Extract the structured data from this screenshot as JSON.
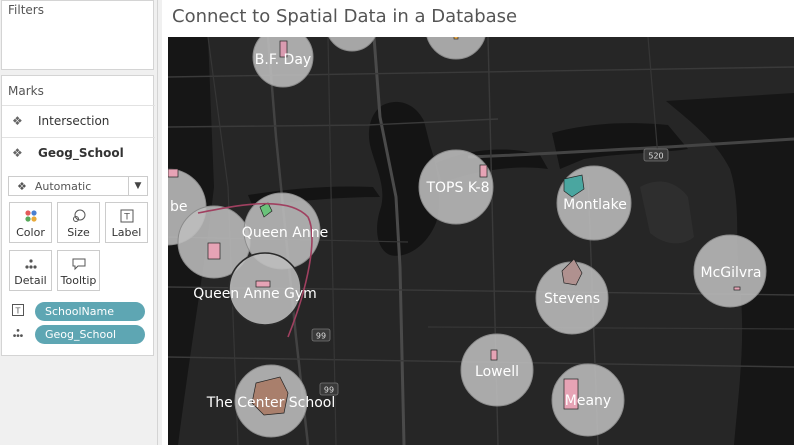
{
  "sidebar": {
    "filters_title": "Filters",
    "marks_title": "Marks",
    "layers": [
      {
        "label": "Intersection",
        "icon": "map-icon"
      },
      {
        "label": "Geog_School",
        "icon": "map-icon"
      }
    ],
    "mark_type": "Automatic",
    "buttons": [
      {
        "label": "Color",
        "icon": "color-dots-icon"
      },
      {
        "label": "Size",
        "icon": "size-icon"
      },
      {
        "label": "Label",
        "icon": "label-icon"
      },
      {
        "label": "Detail",
        "icon": "detail-icon"
      },
      {
        "label": "Tooltip",
        "icon": "tooltip-icon"
      }
    ],
    "pills": [
      {
        "label": "SchoolName",
        "icon": "text-icon"
      },
      {
        "label": "Geog_School",
        "icon": "detail-icon"
      }
    ]
  },
  "main": {
    "title": "Connect to Spatial Data in a Database",
    "highway_label": "520",
    "road_label_1": "99",
    "road_label_2": "99",
    "schools": [
      {
        "name": "B.F. Day"
      },
      {
        "name": "TOPS K-8"
      },
      {
        "name": "Montlake"
      },
      {
        "name": "Queen Anne"
      },
      {
        "name": "Queen Anne Gym"
      },
      {
        "name": "McGilvra"
      },
      {
        "name": "Stevens"
      },
      {
        "name": "Lowell"
      },
      {
        "name": "The Center School"
      },
      {
        "name": "Meany"
      },
      {
        "name": "be"
      }
    ]
  },
  "colors": {
    "pill": "#5ea6b3",
    "map_background": "#262626",
    "water": "#141414",
    "school_circle": "#bdbdbd"
  }
}
